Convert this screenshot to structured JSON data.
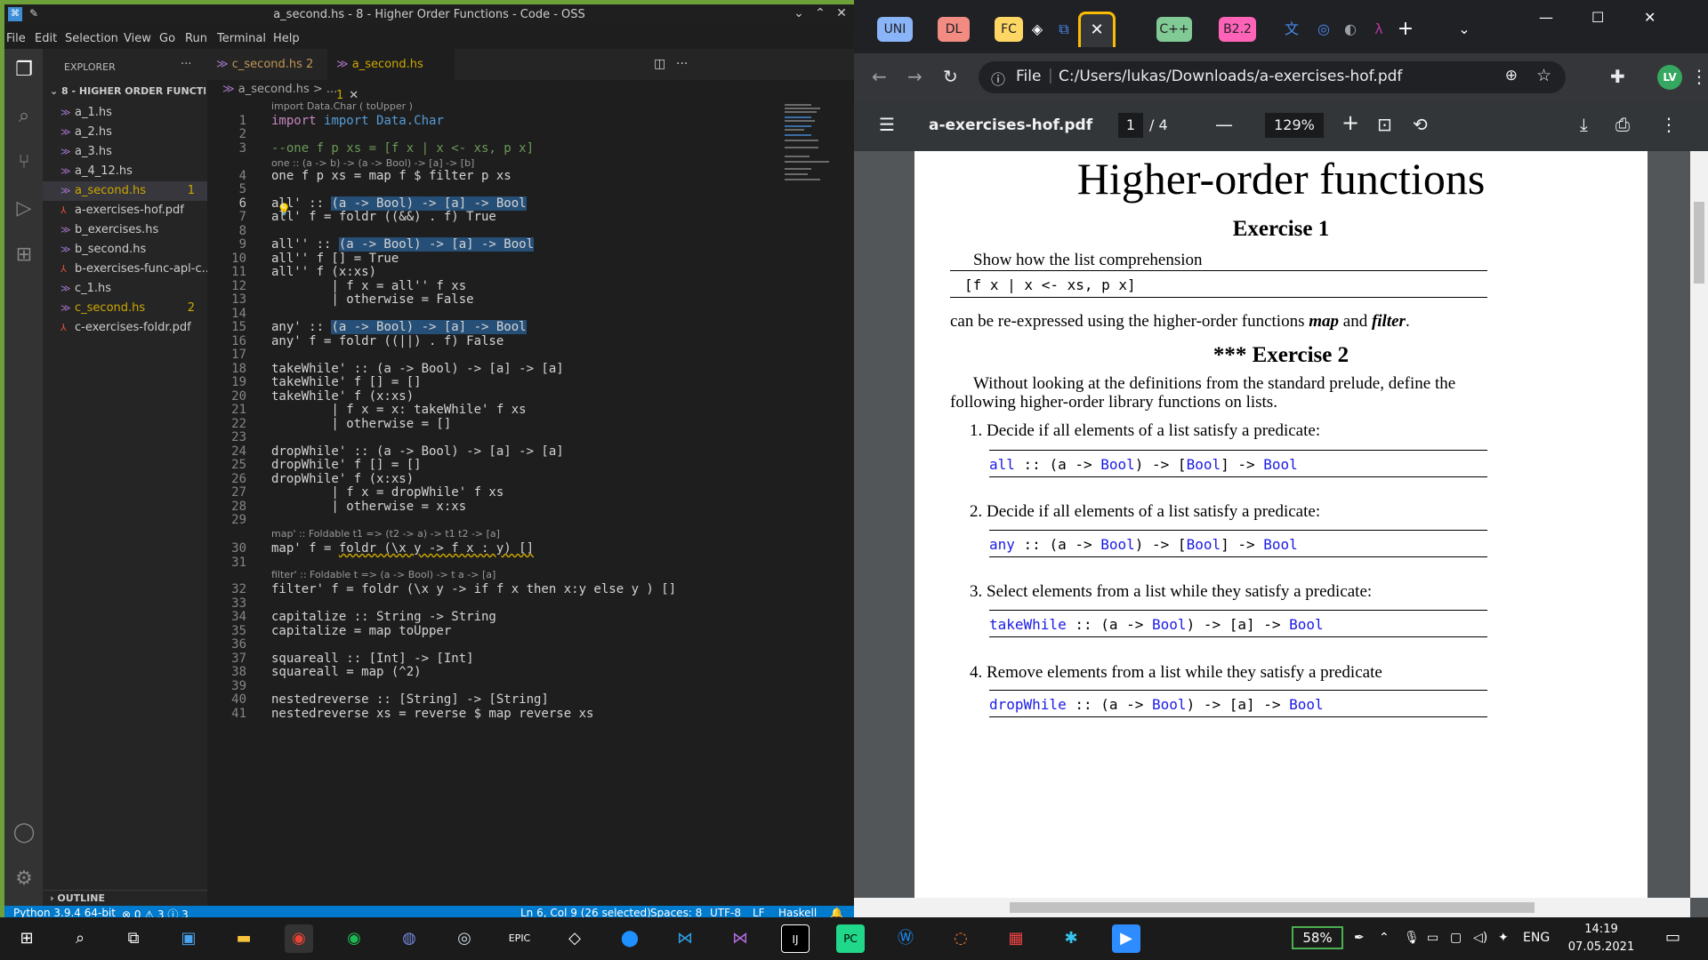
{
  "vscode": {
    "title": "a_second.hs - 8 - Higher Order Functions - Code - OSS",
    "menu": [
      "File",
      "Edit",
      "Selection",
      "View",
      "Go",
      "Run",
      "Terminal",
      "Help"
    ],
    "explorer_label": "EXPLORER",
    "project": "8 - HIGHER ORDER FUNCTIO...",
    "files": [
      {
        "name": "a_1.hs",
        "badge": "",
        "type": "hs"
      },
      {
        "name": "a_2.hs",
        "badge": "",
        "type": "hs"
      },
      {
        "name": "a_3.hs",
        "badge": "",
        "type": "hs"
      },
      {
        "name": "a_4_12.hs",
        "badge": "",
        "type": "hs"
      },
      {
        "name": "a_second.hs",
        "badge": "1",
        "type": "hs"
      },
      {
        "name": "a-exercises-hof.pdf",
        "badge": "",
        "type": "pdf"
      },
      {
        "name": "b_exercises.hs",
        "badge": "",
        "type": "hs"
      },
      {
        "name": "b_second.hs",
        "badge": "",
        "type": "hs"
      },
      {
        "name": "b-exercises-func-apl-c...",
        "badge": "",
        "type": "pdf"
      },
      {
        "name": "c_1.hs",
        "badge": "",
        "type": "hs"
      },
      {
        "name": "c_second.hs",
        "badge": "2",
        "type": "hs"
      },
      {
        "name": "c-exercises-foldr.pdf",
        "badge": "",
        "type": "pdf"
      }
    ],
    "outline_label": "OUTLINE",
    "tabs": [
      {
        "label": "c_second.hs 2"
      },
      {
        "label": "a_second.hs 1"
      }
    ],
    "breadcrumb": "a_second.hs > ...",
    "hint_import": "import Data.Char ( toUpper )",
    "hint_one": "one :: (a -> b) -> (a -> Bool) -> [a] -> [b]",
    "hint_map": "map' :: Foldable t1 => (t2 -> a) -> t1 t2 -> [a]",
    "hint_filter": "filter' :: Foldable t => (a -> Bool) -> t a -> [a]",
    "code": {
      "l1": "import Data.Char",
      "l3": "--one f p xs = [f x | x <- xs, p x]",
      "l4": "one f p xs = map f $ filter p xs",
      "l6a": "all' :: ",
      "l6b": "(a -> Bool) -> [a] -> Bool",
      "l7": "all' f = foldr ((&&) . f) True",
      "l9a": "all'' :: ",
      "l9b": "(a -> Bool) -> [a] -> Bool",
      "l10": "all'' f [] = True",
      "l11": "all'' f (x:xs)",
      "l12": "        | f x = all'' f xs",
      "l13": "        | otherwise = False",
      "l15a": "any' :: ",
      "l15b": "(a -> Bool) -> [a] -> Bool",
      "l16": "any' f = foldr ((||) . f) False",
      "l18": "takeWhile' :: (a -> Bool) -> [a] -> [a]",
      "l19": "takeWhile' f [] = []",
      "l20": "takeWhile' f (x:xs)",
      "l21": "        | f x = x: takeWhile' f xs",
      "l22": "        | otherwise = []",
      "l24": "dropWhile' :: (a -> Bool) -> [a] -> [a]",
      "l25": "dropWhile' f [] = []",
      "l26": "dropWhile' f (x:xs)",
      "l27": "        | f x = dropWhile' f xs",
      "l28": "        | otherwise = x:xs",
      "l30a": "map' f = ",
      "l30b": "foldr (\\x y -> f x : y) []",
      "l32": "filter' f = foldr (\\x y -> if f x then x:y else y ) []",
      "l34": "capitalize :: String -> String",
      "l35": "capitalize = map toUpper",
      "l37": "squareall :: [Int] -> [Int]",
      "l38": "squareall = map (^2)",
      "l40": "nestedreverse :: [String] -> [String]",
      "l41": "nestedreverse xs = reverse $ map reverse xs"
    },
    "status": {
      "python": "Python 3.9.4 64-bit",
      "problems": "⊗ 0 ⚠ 3 ⓘ 3",
      "position": "Ln 6, Col 9 (26 selected)",
      "spaces": "Spaces: 8",
      "encoding": "UTF-8",
      "eol": "LF",
      "language": "Haskell"
    }
  },
  "chrome": {
    "tabs": [
      {
        "label": "UNI",
        "color": "#8ab4f8"
      },
      {
        "label": "DL",
        "color": "#f28b82"
      },
      {
        "label": "FC",
        "color": "#fdd663"
      },
      {
        "label": "C++",
        "color": "#81c995"
      },
      {
        "label": "B2.2",
        "color": "#ff63b8"
      }
    ],
    "url_scheme": "File",
    "url": "C:/Users/lukas/Downloads/a-exercises-hof.pdf",
    "avatar": "LV",
    "pdf": {
      "filename": "a-exercises-hof.pdf",
      "page": "1",
      "pages": "/  4",
      "zoom": "129%",
      "title": "Higher-order functions",
      "ex1": "Exercise 1",
      "ex1_text": "Show how the list comprehension",
      "ex1_code": "[f x | x <- xs, p x]",
      "ex1_after_a": "can be re-expressed using the higher-order functions ",
      "ex1_map": "map",
      "ex1_and": " and ",
      "ex1_filter": "filter",
      "ex1_dot": ".",
      "ex2": "*** Exercise 2",
      "ex2_p1": "Without looking at the definitions from the standard prelude, define the",
      "ex2_p2": "following higher-order library functions on lists.",
      "items": [
        {
          "num": "1.",
          "text": "Decide if all elements of a list satisfy a predicate:",
          "fn": "all",
          "sig": " :: (a -> ",
          "t1": "Bool",
          ") -> [": "",
          "t2": "Bool",
          "end": "Bool"
        },
        {
          "num": "2.",
          "text": "Decide if all elements of a list satisfy a predicate:",
          "fn": "any"
        },
        {
          "num": "3.",
          "text": "Select elements from a list while they satisfy a predicate:",
          "fn": "takeWhile"
        },
        {
          "num": "4.",
          "text": "Remove elements from a list while they satisfy a predicate",
          "fn": "dropWhile"
        }
      ],
      "bool": "Bool"
    }
  },
  "taskbar": {
    "battery": "58%",
    "lang": "ENG",
    "time": "14:19",
    "date": "07.05.2021"
  }
}
